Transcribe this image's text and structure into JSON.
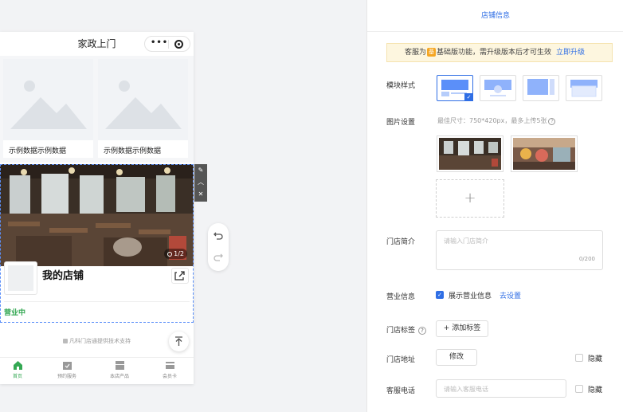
{
  "phone": {
    "title": "家政上门",
    "menu_dots": "•••",
    "cards": [
      {
        "caption": "示例数据示例数据"
      },
      {
        "caption": "示例数据示例数据"
      }
    ],
    "banner_counter": "1/2",
    "store_name": "我的店铺",
    "open_status": "营业中",
    "support_text": "凡科门店通提供技术支持",
    "tabs": [
      {
        "label": "首页",
        "icon": "home-icon",
        "active": true
      },
      {
        "label": "预约服务",
        "icon": "calendar-check-icon",
        "active": false
      },
      {
        "label": "本店产品",
        "icon": "product-icon",
        "active": false
      },
      {
        "label": "会员卡",
        "icon": "member-card-icon",
        "active": false
      }
    ]
  },
  "selection_tools": [
    "edit-icon",
    "move-up-icon",
    "close-icon"
  ],
  "panel": {
    "title": "店铺信息",
    "notice": {
      "prefix": "客服为",
      "badge": "基",
      "suffix": "基础版功能，需升级版本后才可生效",
      "link": "立即升级"
    },
    "module_style_label": "模块样式",
    "image_settings_label": "图片设置",
    "image_hint": "最佳尺寸：750*420px，最多上传5张",
    "image_hint_q": "?",
    "add_image": "+",
    "intro_label": "门店简介",
    "intro_placeholder": "请输入门店简介",
    "intro_count": "0/200",
    "business_label": "营业信息",
    "show_business": "展示营业信息",
    "business_link": "去设置",
    "tags_label": "门店标签",
    "tags_q": "?",
    "add_tag": "+  添加标签",
    "address_label": "门店地址",
    "modify": "修改",
    "hide1": "隐藏",
    "phone_label": "客服电话",
    "phone_placeholder": "请输入客服电话",
    "hide2": "隐藏"
  },
  "colors": {
    "accent": "#2f6ee5",
    "open_green": "#34a853",
    "notice_bg": "#fdf6df",
    "badge_orange": "#f5a623"
  }
}
